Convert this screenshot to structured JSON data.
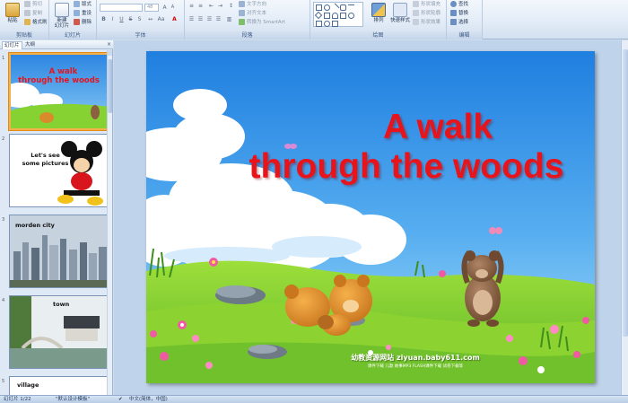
{
  "ribbon": {
    "groups": {
      "clipboard": "剪贴板",
      "slides": "幻灯片",
      "font": "字体",
      "paragraph": "段落",
      "drawing": "绘图",
      "editing": "编辑"
    },
    "paste": "粘贴",
    "cut": "剪切",
    "copy": "复制",
    "format_painter": "格式刷",
    "new_slide": "新建\n幻灯片",
    "layout": "版式",
    "reset": "重设",
    "delete": "删除",
    "font_size": "48",
    "text_direction": "文字方向",
    "align_text": "对齐文本",
    "smartart": "转换为 SmartArt",
    "arrange": "排列",
    "quick_styles": "快速样式",
    "shape_fill": "形状填充",
    "shape_outline": "形状轮廓",
    "shape_effects": "形状效果",
    "find": "查找",
    "replace": "替换",
    "select": "选择"
  },
  "pane": {
    "tab_slides": "幻灯片",
    "tab_outline": "大纲",
    "close": "×"
  },
  "thumbnails": [
    {
      "num": "1",
      "title_line1": "A walk",
      "title_line2": "through the woods"
    },
    {
      "num": "2",
      "text_line1": "Let's see",
      "text_line2": "some pictures"
    },
    {
      "num": "3",
      "text": "morden city"
    },
    {
      "num": "4",
      "text": "town"
    },
    {
      "num": "5",
      "text": "village"
    }
  ],
  "slide": {
    "title_line1": "A walk",
    "title_line2": "through the woods",
    "watermark": "幼教资源网站 ziyuan.baby611.com",
    "watermark_sub": "课件下载   儿歌   故事MP3   FLASH课件下载   试卷下载等"
  },
  "status": {
    "slide_count": "幻灯片 1/22",
    "theme": "\"默认设计模板\"",
    "language": "中文(简体，中国)"
  },
  "colors": {
    "title_red": "#e8141c",
    "sky_blue": "#2f8fe6",
    "grass_green": "#7fcc2a",
    "selection_orange": "#f5b04a"
  }
}
